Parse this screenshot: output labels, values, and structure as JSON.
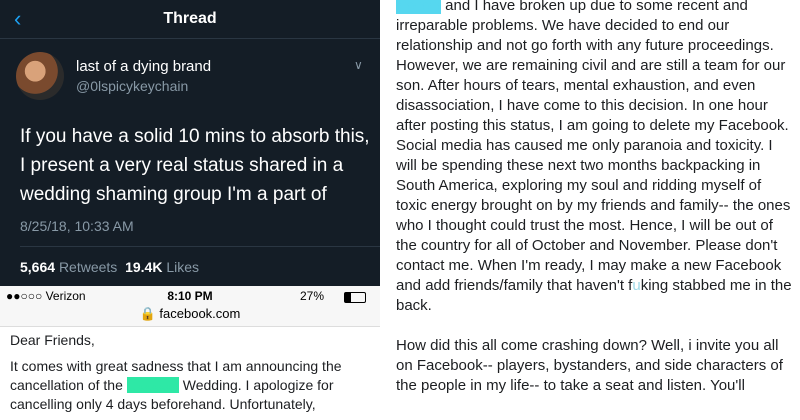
{
  "tweet": {
    "header_title": "Thread",
    "back_icon": "chevron-left-icon",
    "author_name": "last of a dying brand",
    "author_handle": "@0lspicykeychain",
    "text": "If you have a solid 10 mins to absorb this, I present a very real status shared in a wedding shaming group I'm a part of",
    "timestamp": "8/25/18, 10:33 AM",
    "retweets_count": "5,664",
    "retweets_label": "Retweets",
    "likes_count": "19.4K",
    "likes_label": "Likes"
  },
  "phone": {
    "carrier": "●●○○○ Verizon",
    "time": "8:10 PM",
    "battery": "27%",
    "url": "🔒 facebook.com"
  },
  "letter": {
    "greeting": "Dear Friends,",
    "line_start": "It comes with great sadness that I am announcing the cancellation of the",
    "line_end": "Wedding. I apologize for cancelling only 4 days beforehand. Unfortunately,"
  },
  "post": {
    "para1_end": "and I have broken up due to some recent and irreparable problems. We have decided to end our relationship and not go forth with any future proceedings. However, we are remaining civil and are still a team for our son. After hours of tears, mental exhaustion, and even disassociation, I have come to this decision. In one hour after posting this status, I am going to delete my Facebook. Social media has caused me only paranoia and toxicity. I will be spending these next two months backpacking in South America, exploring my soul and ridding myself of toxic energy brought on by my friends and family-- the ones who I thought could trust the most. Hence, I will be out of the country for all of October and November. Please don't contact me. When I'm ready, I may make a new Facebook and add friends/family that haven't f",
    "censored": "u",
    "para1_tail": "king stabbed me in the back.",
    "para2": "How did this all come crashing down? Well, i invite you all on Facebook-- players, bystanders, and side characters of the people in my life-- to take a seat and listen. You'll"
  }
}
